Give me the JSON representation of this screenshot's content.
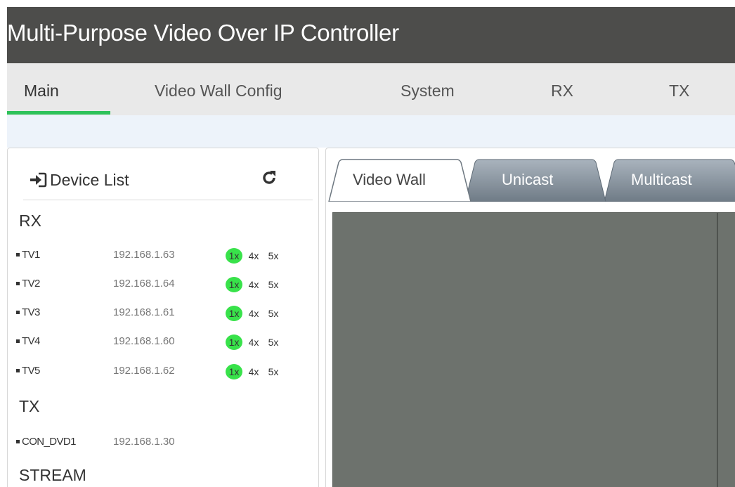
{
  "app": {
    "title": "Multi-Purpose Video Over IP Controller"
  },
  "nav": {
    "tabs": [
      {
        "label": "Main",
        "active": true
      },
      {
        "label": "Video Wall Config",
        "active": false
      },
      {
        "label": "System",
        "active": false
      },
      {
        "label": "RX",
        "active": false
      },
      {
        "label": "TX",
        "active": false
      }
    ]
  },
  "sidebar": {
    "title": "Device List",
    "icons": {
      "header": "login-icon",
      "refresh": "refresh-icon"
    },
    "sections": {
      "rx": {
        "label": "RX",
        "devices": [
          {
            "name": "TV1",
            "ip": "192.168.1.63",
            "modes": [
              "1x",
              "4x",
              "5x"
            ],
            "active_mode": "1x"
          },
          {
            "name": "TV2",
            "ip": "192.168.1.64",
            "modes": [
              "1x",
              "4x",
              "5x"
            ],
            "active_mode": "1x"
          },
          {
            "name": "TV3",
            "ip": "192.168.1.61",
            "modes": [
              "1x",
              "4x",
              "5x"
            ],
            "active_mode": "1x"
          },
          {
            "name": "TV4",
            "ip": "192.168.1.60",
            "modes": [
              "1x",
              "4x",
              "5x"
            ],
            "active_mode": "1x"
          },
          {
            "name": "TV5",
            "ip": "192.168.1.62",
            "modes": [
              "1x",
              "4x",
              "5x"
            ],
            "active_mode": "1x"
          }
        ]
      },
      "tx": {
        "label": "TX",
        "devices": [
          {
            "name": "CON_DVD1",
            "ip": "192.168.1.30"
          }
        ]
      },
      "stream": {
        "label": "STREAM"
      }
    }
  },
  "content": {
    "tabs": [
      {
        "label": "Video Wall",
        "active": true
      },
      {
        "label": "Unicast",
        "active": false
      },
      {
        "label": "Multicast",
        "active": false
      }
    ]
  },
  "colors": {
    "titlebar": "#4d4d4b",
    "accent_green": "#2ec25a",
    "badge_green": "#38e24a",
    "tab_inactive": "#7f8a95",
    "wall": "#6d726d"
  }
}
